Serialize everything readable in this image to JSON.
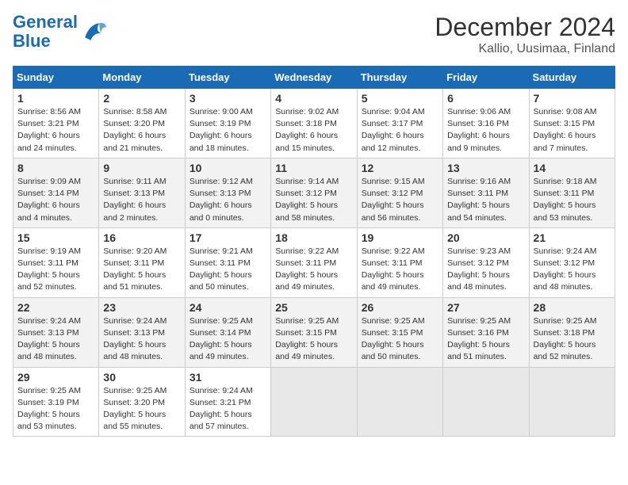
{
  "logo": {
    "line1": "General",
    "line2": "Blue"
  },
  "title": "December 2024",
  "subtitle": "Kallio, Uusimaa, Finland",
  "weekdays": [
    "Sunday",
    "Monday",
    "Tuesday",
    "Wednesday",
    "Thursday",
    "Friday",
    "Saturday"
  ],
  "weeks": [
    [
      {
        "day": "1",
        "sunrise": "Sunrise: 8:56 AM",
        "sunset": "Sunset: 3:21 PM",
        "daylight": "Daylight: 6 hours and 24 minutes."
      },
      {
        "day": "2",
        "sunrise": "Sunrise: 8:58 AM",
        "sunset": "Sunset: 3:20 PM",
        "daylight": "Daylight: 6 hours and 21 minutes."
      },
      {
        "day": "3",
        "sunrise": "Sunrise: 9:00 AM",
        "sunset": "Sunset: 3:19 PM",
        "daylight": "Daylight: 6 hours and 18 minutes."
      },
      {
        "day": "4",
        "sunrise": "Sunrise: 9:02 AM",
        "sunset": "Sunset: 3:18 PM",
        "daylight": "Daylight: 6 hours and 15 minutes."
      },
      {
        "day": "5",
        "sunrise": "Sunrise: 9:04 AM",
        "sunset": "Sunset: 3:17 PM",
        "daylight": "Daylight: 6 hours and 12 minutes."
      },
      {
        "day": "6",
        "sunrise": "Sunrise: 9:06 AM",
        "sunset": "Sunset: 3:16 PM",
        "daylight": "Daylight: 6 hours and 9 minutes."
      },
      {
        "day": "7",
        "sunrise": "Sunrise: 9:08 AM",
        "sunset": "Sunset: 3:15 PM",
        "daylight": "Daylight: 6 hours and 7 minutes."
      }
    ],
    [
      {
        "day": "8",
        "sunrise": "Sunrise: 9:09 AM",
        "sunset": "Sunset: 3:14 PM",
        "daylight": "Daylight: 6 hours and 4 minutes."
      },
      {
        "day": "9",
        "sunrise": "Sunrise: 9:11 AM",
        "sunset": "Sunset: 3:13 PM",
        "daylight": "Daylight: 6 hours and 2 minutes."
      },
      {
        "day": "10",
        "sunrise": "Sunrise: 9:12 AM",
        "sunset": "Sunset: 3:13 PM",
        "daylight": "Daylight: 6 hours and 0 minutes."
      },
      {
        "day": "11",
        "sunrise": "Sunrise: 9:14 AM",
        "sunset": "Sunset: 3:12 PM",
        "daylight": "Daylight: 5 hours and 58 minutes."
      },
      {
        "day": "12",
        "sunrise": "Sunrise: 9:15 AM",
        "sunset": "Sunset: 3:12 PM",
        "daylight": "Daylight: 5 hours and 56 minutes."
      },
      {
        "day": "13",
        "sunrise": "Sunrise: 9:16 AM",
        "sunset": "Sunset: 3:11 PM",
        "daylight": "Daylight: 5 hours and 54 minutes."
      },
      {
        "day": "14",
        "sunrise": "Sunrise: 9:18 AM",
        "sunset": "Sunset: 3:11 PM",
        "daylight": "Daylight: 5 hours and 53 minutes."
      }
    ],
    [
      {
        "day": "15",
        "sunrise": "Sunrise: 9:19 AM",
        "sunset": "Sunset: 3:11 PM",
        "daylight": "Daylight: 5 hours and 52 minutes."
      },
      {
        "day": "16",
        "sunrise": "Sunrise: 9:20 AM",
        "sunset": "Sunset: 3:11 PM",
        "daylight": "Daylight: 5 hours and 51 minutes."
      },
      {
        "day": "17",
        "sunrise": "Sunrise: 9:21 AM",
        "sunset": "Sunset: 3:11 PM",
        "daylight": "Daylight: 5 hours and 50 minutes."
      },
      {
        "day": "18",
        "sunrise": "Sunrise: 9:22 AM",
        "sunset": "Sunset: 3:11 PM",
        "daylight": "Daylight: 5 hours and 49 minutes."
      },
      {
        "day": "19",
        "sunrise": "Sunrise: 9:22 AM",
        "sunset": "Sunset: 3:11 PM",
        "daylight": "Daylight: 5 hours and 49 minutes."
      },
      {
        "day": "20",
        "sunrise": "Sunrise: 9:23 AM",
        "sunset": "Sunset: 3:12 PM",
        "daylight": "Daylight: 5 hours and 48 minutes."
      },
      {
        "day": "21",
        "sunrise": "Sunrise: 9:24 AM",
        "sunset": "Sunset: 3:12 PM",
        "daylight": "Daylight: 5 hours and 48 minutes."
      }
    ],
    [
      {
        "day": "22",
        "sunrise": "Sunrise: 9:24 AM",
        "sunset": "Sunset: 3:13 PM",
        "daylight": "Daylight: 5 hours and 48 minutes."
      },
      {
        "day": "23",
        "sunrise": "Sunrise: 9:24 AM",
        "sunset": "Sunset: 3:13 PM",
        "daylight": "Daylight: 5 hours and 48 minutes."
      },
      {
        "day": "24",
        "sunrise": "Sunrise: 9:25 AM",
        "sunset": "Sunset: 3:14 PM",
        "daylight": "Daylight: 5 hours and 49 minutes."
      },
      {
        "day": "25",
        "sunrise": "Sunrise: 9:25 AM",
        "sunset": "Sunset: 3:15 PM",
        "daylight": "Daylight: 5 hours and 49 minutes."
      },
      {
        "day": "26",
        "sunrise": "Sunrise: 9:25 AM",
        "sunset": "Sunset: 3:15 PM",
        "daylight": "Daylight: 5 hours and 50 minutes."
      },
      {
        "day": "27",
        "sunrise": "Sunrise: 9:25 AM",
        "sunset": "Sunset: 3:16 PM",
        "daylight": "Daylight: 5 hours and 51 minutes."
      },
      {
        "day": "28",
        "sunrise": "Sunrise: 9:25 AM",
        "sunset": "Sunset: 3:18 PM",
        "daylight": "Daylight: 5 hours and 52 minutes."
      }
    ],
    [
      {
        "day": "29",
        "sunrise": "Sunrise: 9:25 AM",
        "sunset": "Sunset: 3:19 PM",
        "daylight": "Daylight: 5 hours and 53 minutes."
      },
      {
        "day": "30",
        "sunrise": "Sunrise: 9:25 AM",
        "sunset": "Sunset: 3:20 PM",
        "daylight": "Daylight: 5 hours and 55 minutes."
      },
      {
        "day": "31",
        "sunrise": "Sunrise: 9:24 AM",
        "sunset": "Sunset: 3:21 PM",
        "daylight": "Daylight: 5 hours and 57 minutes."
      },
      null,
      null,
      null,
      null
    ]
  ]
}
